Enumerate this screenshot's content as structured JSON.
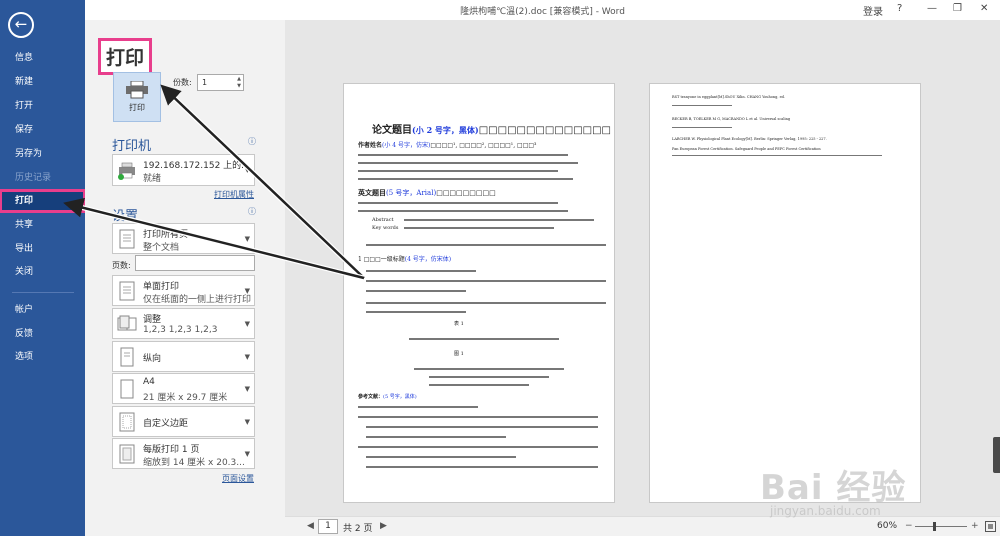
{
  "window": {
    "title": "隆烘枸哺℃溫(2).doc [兼容模式] - Word",
    "login": "登录",
    "help": "?",
    "minimize": "—",
    "restore": "❐",
    "close": "✕"
  },
  "sidebar": {
    "back": "←",
    "items": [
      {
        "label": "信息"
      },
      {
        "label": "新建"
      },
      {
        "label": "打开"
      },
      {
        "label": "保存"
      },
      {
        "label": "另存为"
      },
      {
        "label": "历史记录"
      },
      {
        "label": "打印"
      },
      {
        "label": "共享"
      },
      {
        "label": "导出"
      },
      {
        "label": "关闭"
      },
      {
        "label": "帐户"
      },
      {
        "label": "反馈"
      },
      {
        "label": "选项"
      }
    ]
  },
  "print": {
    "heading": "打印",
    "button_label": "打印",
    "copies_label": "份数:",
    "copies_value": "1",
    "printer_section": "打印机",
    "printer_name": "192.168.172.152 上的...",
    "printer_status": "就绪",
    "printer_props": "打印机属性",
    "settings_section": "设置",
    "print_all_line1": "打印所有页",
    "print_all_line2": "整个文档",
    "pages_label": "页数:",
    "pages_value": "",
    "sided_line1": "单面打印",
    "sided_line2": "仅在纸面的一侧上进行打印",
    "collate_line1": "调整",
    "collate_line2": "1,2,3    1,2,3    1,2,3",
    "orientation": "纵向",
    "paper_line1": "A4",
    "paper_line2": "21 厘米 x 29.7 厘米",
    "margins": "自定义边距",
    "perpage_line1": "每版打印 1 页",
    "perpage_line2": "缩放到 14 厘米 x 20.3...",
    "page_setup": "页面设置"
  },
  "status": {
    "page_current": "1",
    "page_total": "共 2 页",
    "prev": "◀",
    "next": "▶",
    "zoom": "60%",
    "zoom_minus": "−",
    "zoom_plus": "+"
  },
  "preview": {
    "p1": {
      "title": "论文题目",
      "title_note": "(小 2 号字，黑体)",
      "title_boxes": "□□□□□□□□□□□□□□",
      "author": "作者姓名",
      "author_note": "(小 4 号字，仿宋)",
      "author_rest": "□□□□¹, □□□□², □□□□¹, □□□³",
      "en_title": "英文题目",
      "en_title_note": "(5 号字，Arial)",
      "en_title_boxes": "□□□□□□□□□",
      "abstract_label": "Abstract",
      "keywords_label": "Key words",
      "h1": "1 □□□一级标题",
      "h1_note": "(4 号字，仿宋体)",
      "refs": "参考文献：",
      "refs_note": "(5 号字，黑体)",
      "fig": "图 1",
      "table": "表 1"
    },
    "p2": {
      "r1": "RST tranyone in eggplant[M].ShOU Xilin. CHANG Youhong, ed.",
      "r2": "BECKER B, TOELKER M G, MACRANDO L et al. Universal scaling",
      "r3": "LARCHER W. Physiological Plant Ecology[M]. Berlin: Springer Verlag, 1995: 225 - 227.",
      "r4": "Pan European Forest Certification. Safeguard People and PEFC Forest Certification"
    }
  },
  "watermark": {
    "main": "Bai 经验",
    "sub": "jingyan.baidu.com"
  }
}
